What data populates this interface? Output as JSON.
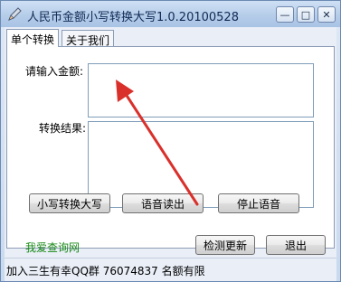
{
  "window": {
    "title": "人民币金额小写转换大写1.0.20100528",
    "min_label": "—",
    "max_label": "□",
    "close_label": "✕"
  },
  "tabs": [
    {
      "label": "单个转换",
      "active": true
    },
    {
      "label": "关于我们",
      "active": false
    }
  ],
  "form": {
    "input_label": "请输入金额:",
    "input_value": "",
    "result_label": "转换结果:",
    "result_value": ""
  },
  "buttons": {
    "convert": "小写转换大写",
    "read_aloud": "语音读出",
    "stop_voice": "停止语音",
    "check_update": "检测更新",
    "exit": "退出"
  },
  "link": {
    "label": "我爱查询网"
  },
  "status": {
    "text": "加入三生有幸QQ群 76074837 名额有限"
  },
  "colors": {
    "annotation_arrow": "#d9302b",
    "link": "#1a8a18"
  },
  "icons": {
    "app": "pen-icon",
    "annotation": "red-arrow"
  }
}
